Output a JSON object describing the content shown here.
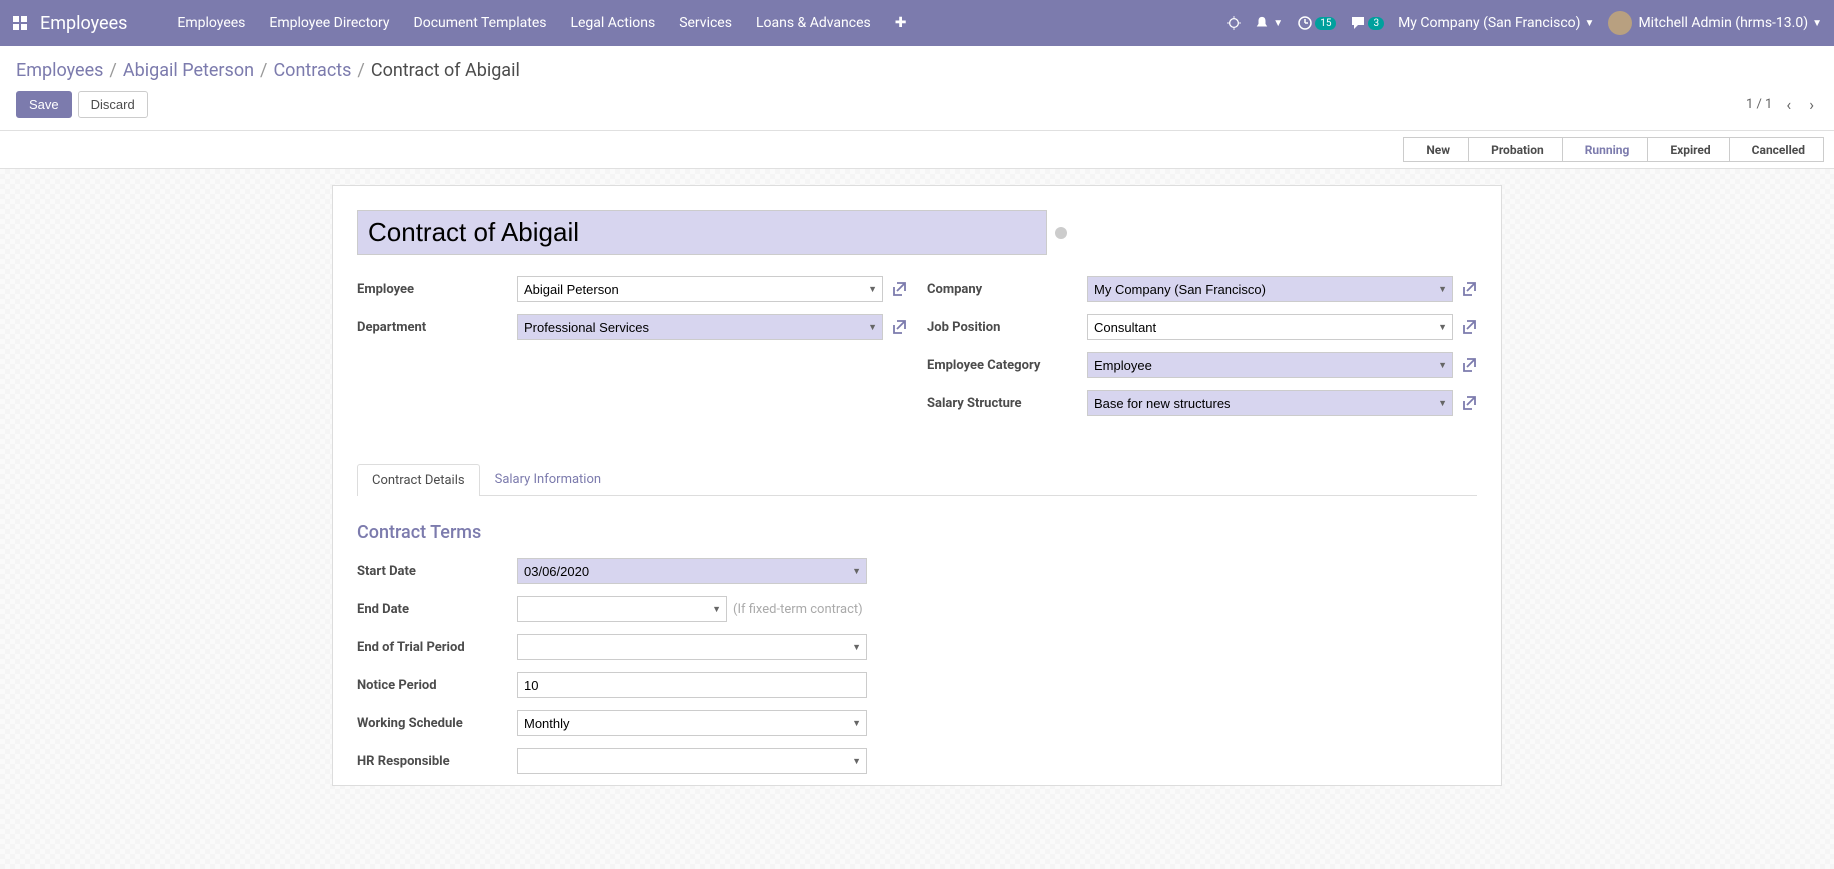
{
  "navbar": {
    "brand": "Employees",
    "menu": [
      "Employees",
      "Employee Directory",
      "Document Templates",
      "Legal Actions",
      "Services",
      "Loans & Advances"
    ],
    "clock_badge": "15",
    "chat_badge": "3",
    "company": "My Company (San Francisco)",
    "user": "Mitchell Admin (hrms-13.0)"
  },
  "breadcrumb": {
    "items": [
      "Employees",
      "Abigail Peterson",
      "Contracts"
    ],
    "current": "Contract of Abigail"
  },
  "actions": {
    "save": "Save",
    "discard": "Discard",
    "pager": "1 / 1"
  },
  "status": {
    "steps": [
      "New",
      "Probation",
      "Running",
      "Expired",
      "Cancelled"
    ],
    "active_index": 2
  },
  "form": {
    "title": "Contract of Abigail",
    "left": {
      "employee_label": "Employee",
      "employee_value": "Abigail Peterson",
      "department_label": "Department",
      "department_value": "Professional Services"
    },
    "right": {
      "company_label": "Company",
      "company_value": "My Company (San Francisco)",
      "job_label": "Job Position",
      "job_value": "Consultant",
      "category_label": "Employee Category",
      "category_value": "Employee",
      "salary_struct_label": "Salary Structure",
      "salary_struct_value": "Base for new structures"
    },
    "tabs": [
      "Contract Details",
      "Salary Information"
    ],
    "section_title": "Contract Terms",
    "terms": {
      "start_date_label": "Start Date",
      "start_date_value": "03/06/2020",
      "end_date_label": "End Date",
      "end_date_value": "",
      "end_date_hint": "(If fixed-term contract)",
      "trial_label": "End of Trial Period",
      "trial_value": "",
      "notice_label": "Notice Period",
      "notice_value": "10",
      "schedule_label": "Working Schedule",
      "schedule_value": "Monthly",
      "hr_label": "HR Responsible",
      "hr_value": ""
    }
  }
}
